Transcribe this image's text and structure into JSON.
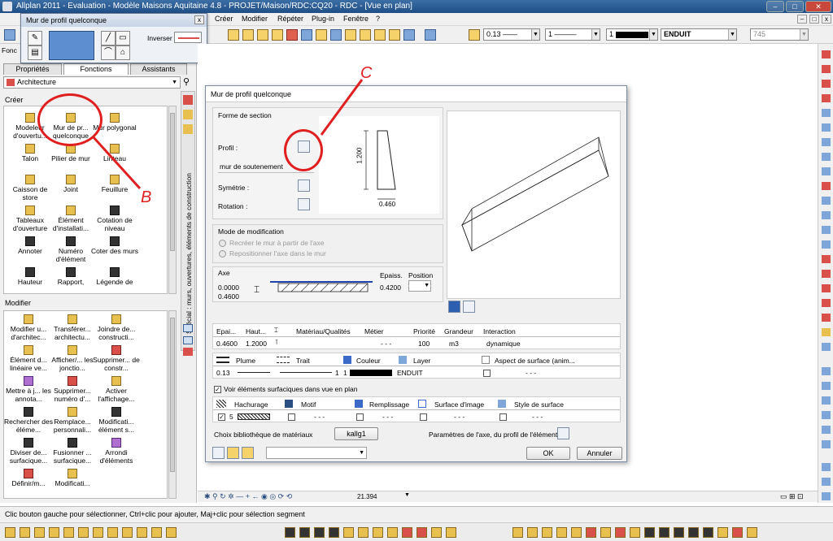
{
  "window": {
    "title": "Allplan 2011 - Evaluation - Modèle Maisons Aquitaine 4.8 - PROJET/Maison/RDC:CQ20 - RDC - [Vue en plan]"
  },
  "menu": [
    "Créer",
    "Modifier",
    "Répéter",
    "Plug-in",
    "Fenêtre",
    "?"
  ],
  "toolbar": {
    "pen": "0.13",
    "line": "1",
    "color": "1",
    "layer": "ENDUIT",
    "scale": "745"
  },
  "small_window": {
    "title": "Mur de profil quelconque",
    "inverser": "Inverser",
    "close": "x"
  },
  "left_panel": {
    "left_edge": "Fonc",
    "tabs": [
      "Propriétés",
      "Fonctions",
      "Assistants"
    ],
    "dropdown": "Architecture",
    "create_title": "Créer",
    "create_tools": [
      "Modeleur d'ouvertu...",
      "Mur de pr... quelconque",
      "Mur polygonal",
      "Talon",
      "Pilier de mur",
      "Linteau",
      "Caisson de store",
      "Joint",
      "Feuillure",
      "Tableaux d'ouverture",
      "Élément d'installati...",
      "Cotation de niveau",
      "Annoter",
      "Numéro d'élément",
      "Coter des murs",
      "Hauteur",
      "Rapport,",
      "Légende de"
    ],
    "modify_title": "Modifier",
    "modify_tools": [
      "Modifier u... d'architec...",
      "Transférer... architectu...",
      "Joindre de... constructi...",
      "Élément d... linéaire ve...",
      "Afficher/... les jonctio...",
      "Supprimer... de constr...",
      "Mettre à j... les annota...",
      "Supprimer... numéro d'...",
      "Activer l'affichage...",
      "Rechercher des éléme...",
      "Remplace... personnali...",
      "Modificati... élément s...",
      "Diviser de... surfacique...",
      "Fusionner ... surfacique...",
      "Arrondi d'éléments",
      "Définir/m...",
      "Modificati..."
    ],
    "vertical_tab": "Spécial : murs, ouvertures, éléments de construction"
  },
  "annotations": {
    "b": "B",
    "c": "C"
  },
  "dialog": {
    "title": "Mur de profil quelconque",
    "forme_section": "Forme de section",
    "profil_label": "Profil :",
    "profil_name": "mur de soutenement",
    "symetrie": "Symétrie :",
    "rotation": "Rotation :",
    "dim_height": "1.200",
    "dim_width": "0.460",
    "mode_title": "Mode de modification",
    "mode_opt1": "Recréer le mur à partir de l'axe",
    "mode_opt2": "Repositionner l'axe dans le mur",
    "axe_title": "Axe",
    "axe_val1": "0.0000",
    "axe_val2": "0.4600",
    "epaiss_label": "Epaiss.",
    "position_label": "Position",
    "epaiss_val": "0.4200",
    "table1": {
      "headers": [
        "Epai...",
        "Haut...",
        "Matériau/Qualités",
        "Métier",
        "Priorité",
        "Grandeur",
        "Interaction"
      ],
      "row": [
        "0.4600",
        "1.2000",
        "",
        "- - -",
        "100",
        "m3",
        "dynamique"
      ]
    },
    "table2": {
      "headers": [
        "Plume",
        "Trait",
        "Couleur",
        "Layer",
        "Aspect de surface (anim..."
      ],
      "row": [
        "0.13",
        "1",
        "1",
        "ENDUIT",
        "- - -"
      ]
    },
    "voir_elements": "Voir éléments surfaciques dans vue en plan",
    "table3": {
      "headers": [
        "Hachurage",
        "Motif",
        "Remplissage",
        "Surface d'image",
        "Style de surface"
      ],
      "row": [
        "5",
        "- - -",
        "- - -",
        "- - -",
        "- - -"
      ]
    },
    "choix_biblio": "Choix bibliothèque de matériaux",
    "kallg_button": "kallg1",
    "params_axe": "Paramètres de l'axe, du profil de l'élément :",
    "ok": "OK",
    "cancel": "Annuler"
  },
  "navbar": {
    "zoom": "21.394"
  },
  "status": "Clic bouton gauche pour sélectionner, Ctrl+clic pour ajouter, Maj+clic pour sélection segment",
  "colors": {
    "titlebar": "#1f4e86",
    "annotation": "#e02020",
    "dialog_border": "#7b8ca4"
  }
}
